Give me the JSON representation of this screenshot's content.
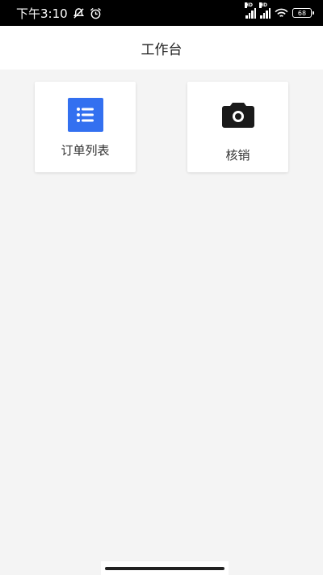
{
  "status_bar": {
    "time": "下午3:10",
    "hd1": "HD",
    "hd2": "HD",
    "battery": "68"
  },
  "header": {
    "title": "工作台"
  },
  "cards": [
    {
      "label": "订单列表",
      "icon": "list-icon",
      "icon_color": "#3370f0"
    },
    {
      "label": "核销",
      "icon": "camera-icon",
      "icon_color": "#1a1a1a"
    }
  ],
  "colors": {
    "background": "#f4f4f4",
    "card": "#ffffff",
    "accent": "#3370f0"
  }
}
